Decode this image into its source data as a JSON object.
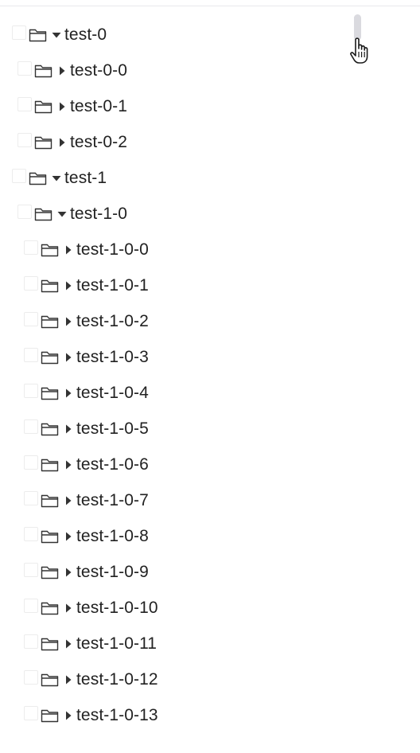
{
  "tree": {
    "nodes": [
      {
        "label": "test-0",
        "level": 0,
        "expanded": true
      },
      {
        "label": "test-0-0",
        "level": 1,
        "expanded": false
      },
      {
        "label": "test-0-1",
        "level": 1,
        "expanded": false
      },
      {
        "label": "test-0-2",
        "level": 1,
        "expanded": false
      },
      {
        "label": "test-1",
        "level": 0,
        "expanded": true
      },
      {
        "label": "test-1-0",
        "level": 1,
        "expanded": true
      },
      {
        "label": "test-1-0-0",
        "level": 2,
        "expanded": false
      },
      {
        "label": "test-1-0-1",
        "level": 2,
        "expanded": false
      },
      {
        "label": "test-1-0-2",
        "level": 2,
        "expanded": false
      },
      {
        "label": "test-1-0-3",
        "level": 2,
        "expanded": false
      },
      {
        "label": "test-1-0-4",
        "level": 2,
        "expanded": false
      },
      {
        "label": "test-1-0-5",
        "level": 2,
        "expanded": false
      },
      {
        "label": "test-1-0-6",
        "level": 2,
        "expanded": false
      },
      {
        "label": "test-1-0-7",
        "level": 2,
        "expanded": false
      },
      {
        "label": "test-1-0-8",
        "level": 2,
        "expanded": false
      },
      {
        "label": "test-1-0-9",
        "level": 2,
        "expanded": false
      },
      {
        "label": "test-1-0-10",
        "level": 2,
        "expanded": false
      },
      {
        "label": "test-1-0-11",
        "level": 2,
        "expanded": false
      },
      {
        "label": "test-1-0-12",
        "level": 2,
        "expanded": false
      },
      {
        "label": "test-1-0-13",
        "level": 2,
        "expanded": false
      }
    ]
  },
  "icons": {
    "folder": "folder-icon",
    "caret_down": "caret-down-icon",
    "caret_right": "caret-right-icon",
    "checkbox": "checkbox",
    "cursor": "hand-pointer-icon"
  },
  "colors": {
    "text": "#222222",
    "icon_stroke": "#333333",
    "checkbox_border": "#ececec",
    "scrollbar_thumb": "#dadadf",
    "divider": "#e8e8ec"
  }
}
